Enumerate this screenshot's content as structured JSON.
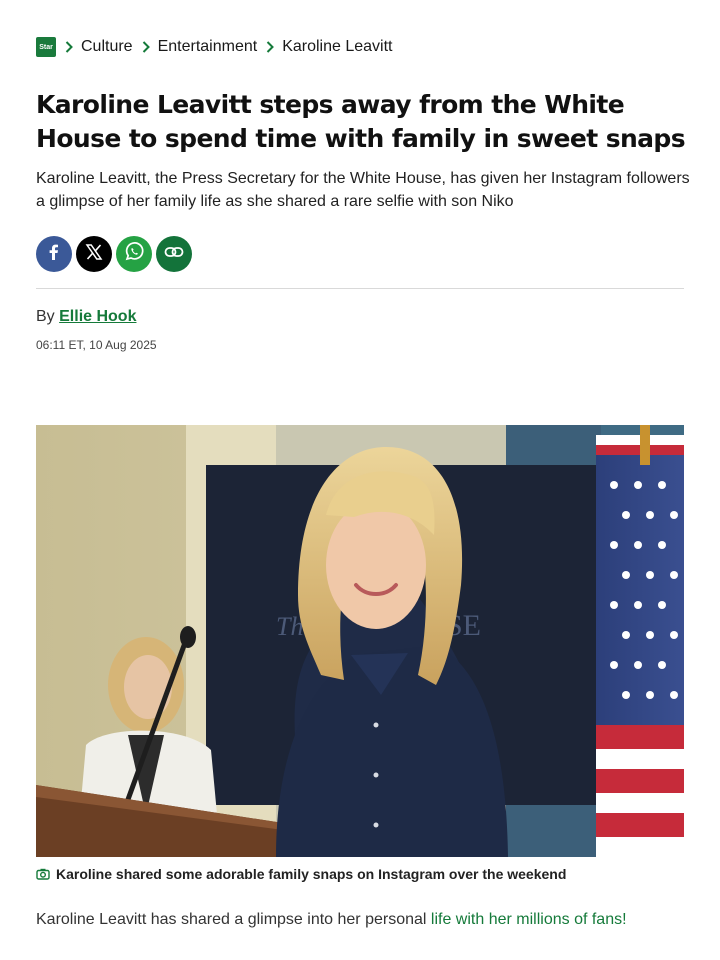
{
  "breadcrumb": {
    "logo_text": "Star",
    "items": [
      "Culture",
      "Entertainment",
      "Karoline Leavitt"
    ]
  },
  "article": {
    "title": "Karoline Leavitt steps away from the White House to spend time with family in sweet snaps",
    "standfirst": "Karoline Leavitt, the Press Secretary for the White House, has given her Instagram followers a glimpse of her family life as she shared a rare selfie with son Niko",
    "byline_prefix": "By",
    "author": "Ellie Hook",
    "date": "06:11 ET, 10 Aug 2025",
    "caption": "Karoline shared some adorable family snaps on Instagram over the weekend",
    "body_start": "Karoline Leavitt has shared a glimpse into her personal ",
    "body_link": "life with her millions of fans!"
  },
  "share": {
    "buttons": [
      "facebook-icon",
      "x-icon",
      "whatsapp-icon",
      "link-icon"
    ]
  },
  "colors": {
    "brand_green": "#157a3a",
    "facebook": "#3b5998",
    "whatsapp": "#25a244"
  }
}
